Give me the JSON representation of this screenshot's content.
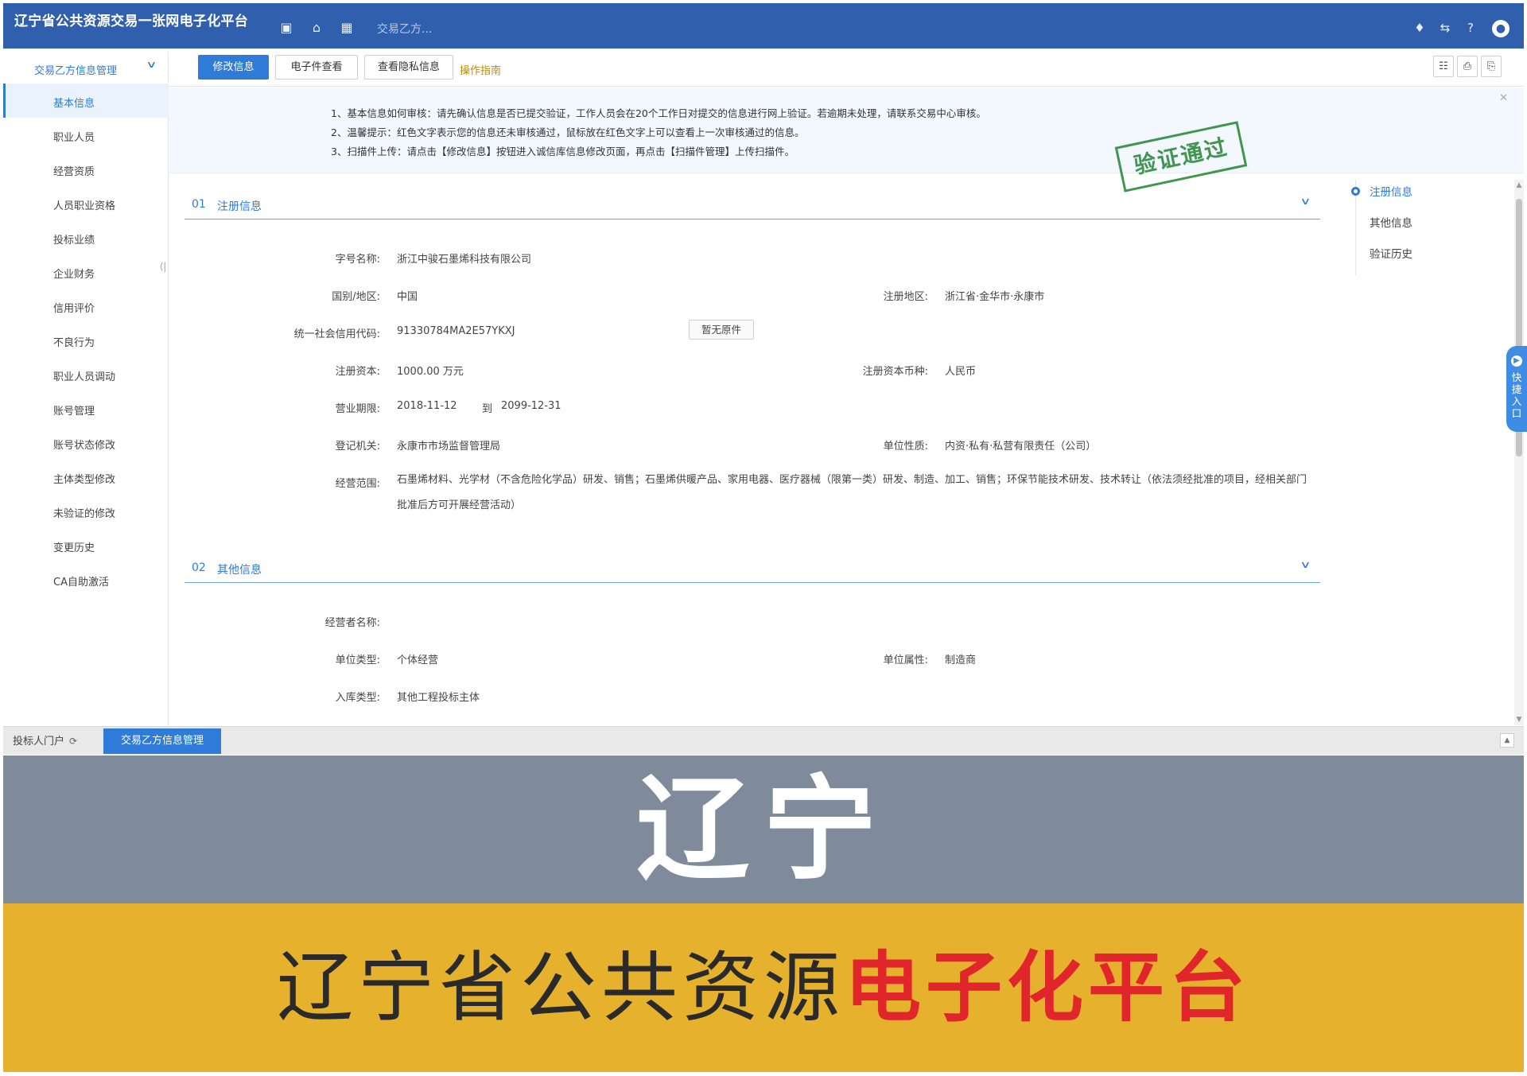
{
  "header": {
    "title": "辽宁省公共资源交易一张网电子化平台",
    "search_placeholder": "交易乙方..."
  },
  "sidebar": {
    "group_label": "交易乙方信息管理",
    "items": [
      {
        "label": "基本信息"
      },
      {
        "label": "职业人员"
      },
      {
        "label": "经营资质"
      },
      {
        "label": "人员职业资格"
      },
      {
        "label": "投标业绩"
      },
      {
        "label": "企业财务"
      },
      {
        "label": "信用评价"
      },
      {
        "label": "不良行为"
      },
      {
        "label": "职业人员调动"
      },
      {
        "label": "账号管理"
      },
      {
        "label": "账号状态修改"
      },
      {
        "label": "主体类型修改"
      },
      {
        "label": "未验证的修改"
      },
      {
        "label": "变更历史"
      },
      {
        "label": "CA自助激活"
      }
    ]
  },
  "toolbar": {
    "edit_label": "修改信息",
    "efile_label": "电子件查看",
    "privacy_label": "查看隐私信息",
    "guide_label": "操作指南"
  },
  "notice": {
    "line1": "1、基本信息如何审核：请先确认信息是否已提交验证，工作人员会在20个工作日对提交的信息进行网上验证。若逾期未处理，请联系交易中心审核。",
    "line2": "2、温馨提示：红色文字表示您的信息还未审核通过，鼠标放在红色文字上可以查看上一次审核通过的信息。",
    "line3": "3、扫描件上传：请点击【修改信息】按钮进入诚信库信息修改页面，再点击【扫描件管理】上传扫描件。"
  },
  "stamp": {
    "text": "验证通过"
  },
  "section1": {
    "num": "01",
    "title": "注册信息",
    "fields": {
      "name_label": "字号名称:",
      "name_value": "浙江中骏石墨烯科技有限公司",
      "country_label": "国别/地区:",
      "country_value": "中国",
      "region_label": "注册地区:",
      "region_value": "浙江省·金华市·永康市",
      "credit_label": "统一社会信用代码:",
      "credit_value": "91330784MA2E57YKXJ",
      "no_original_label": "暂无原件",
      "capital_label": "注册资本:",
      "capital_value": "1000.00 万元",
      "currency_label": "注册资本币种:",
      "currency_value": "人民币",
      "term_label": "营业期限:",
      "term_start": "2018-11-12",
      "term_to": "到",
      "term_end": "2099-12-31",
      "authority_label": "登记机关:",
      "authority_value": "永康市市场监督管理局",
      "nature_label": "单位性质:",
      "nature_value": "内资·私有·私营有限责任（公司）",
      "scope_label": "经营范围:",
      "scope_value": "石墨烯材料、光学材（不含危险化学品）研发、销售；石墨烯供暖产品、家用电器、医疗器械（限第一类）研发、制造、加工、销售；环保节能技术研发、技术转让（依法须经批准的项目，经相关部门批准后方可开展经营活动）"
    }
  },
  "section2": {
    "num": "02",
    "title": "其他信息",
    "fields": {
      "operator_label": "经营者名称:",
      "unit_type_label": "单位类型:",
      "unit_type_value": "个体经营",
      "unit_attr_label": "单位属性:",
      "unit_attr_value": "制造商",
      "storage_label": "入库类型:",
      "storage_value": "其他工程投标主体"
    }
  },
  "anchor_nav": [
    {
      "label": "注册信息"
    },
    {
      "label": "其他信息"
    },
    {
      "label": "验证历史"
    }
  ],
  "quick_entry": {
    "label": "快捷入口"
  },
  "tabs": {
    "home": "投标人门户",
    "current": "交易乙方信息管理"
  },
  "banner": {
    "big_text": "辽宁",
    "tagline_dark": "辽宁省公共资源",
    "tagline_red": "电子化平台"
  },
  "colors": {
    "header_blue": "#2f5fad",
    "accent_blue": "#2f7bd8",
    "stamp_green": "#2e8b3e",
    "banner_grey": "#7f8b9b",
    "banner_gold": "#e6b22e",
    "banner_red": "#e0262a"
  },
  "icons": [
    "monitor-icon",
    "home-icon",
    "grid-icon",
    "bell-icon",
    "transfer-icon",
    "help-icon",
    "user-icon",
    "sitemap-icon",
    "pdf-icon",
    "print-icon",
    "refresh-icon",
    "chevron-down-icon",
    "collapse-icon"
  ]
}
